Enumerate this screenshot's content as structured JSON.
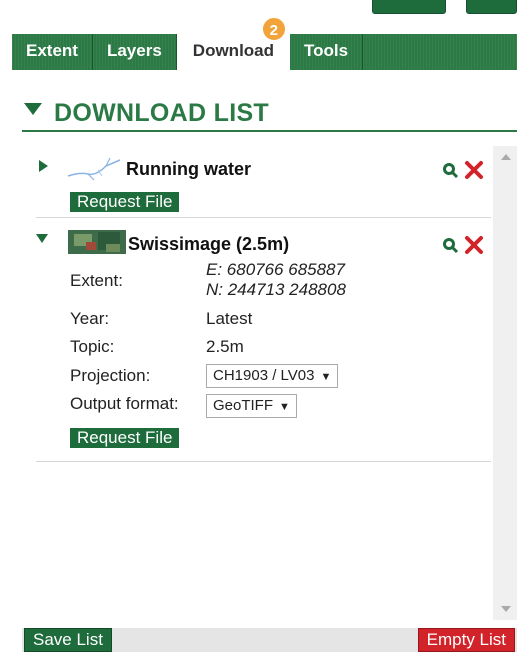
{
  "tabs": [
    {
      "label": "Extent"
    },
    {
      "label": "Layers"
    },
    {
      "label": "Download",
      "badge": "2"
    },
    {
      "label": "Tools"
    }
  ],
  "active_tab": "Download",
  "section": {
    "title": "DOWNLOAD LIST"
  },
  "items": [
    {
      "title": "Running water",
      "expanded": false,
      "request_label": "Request File"
    },
    {
      "title": "Swissimage (2.5m)",
      "expanded": true,
      "fields": {
        "extent_label": "Extent:",
        "extent_e": "E: 680766 685887",
        "extent_n": "N: 244713 248808",
        "year_label": "Year:",
        "year_value": "Latest",
        "topic_label": "Topic:",
        "topic_value": "2.5m",
        "projection_label": "Projection:",
        "projection_value": "CH1903 / LV03",
        "output_label": "Output format:",
        "output_value": "GeoTIFF"
      },
      "request_label": "Request File"
    }
  ],
  "footer": {
    "save_label": "Save List",
    "empty_label": "Empty List"
  },
  "colors": {
    "brand_green": "#1e6b3c",
    "tab_green": "#2b7a45",
    "badge_orange": "#f2a33a",
    "remove_red": "#d2232a"
  }
}
